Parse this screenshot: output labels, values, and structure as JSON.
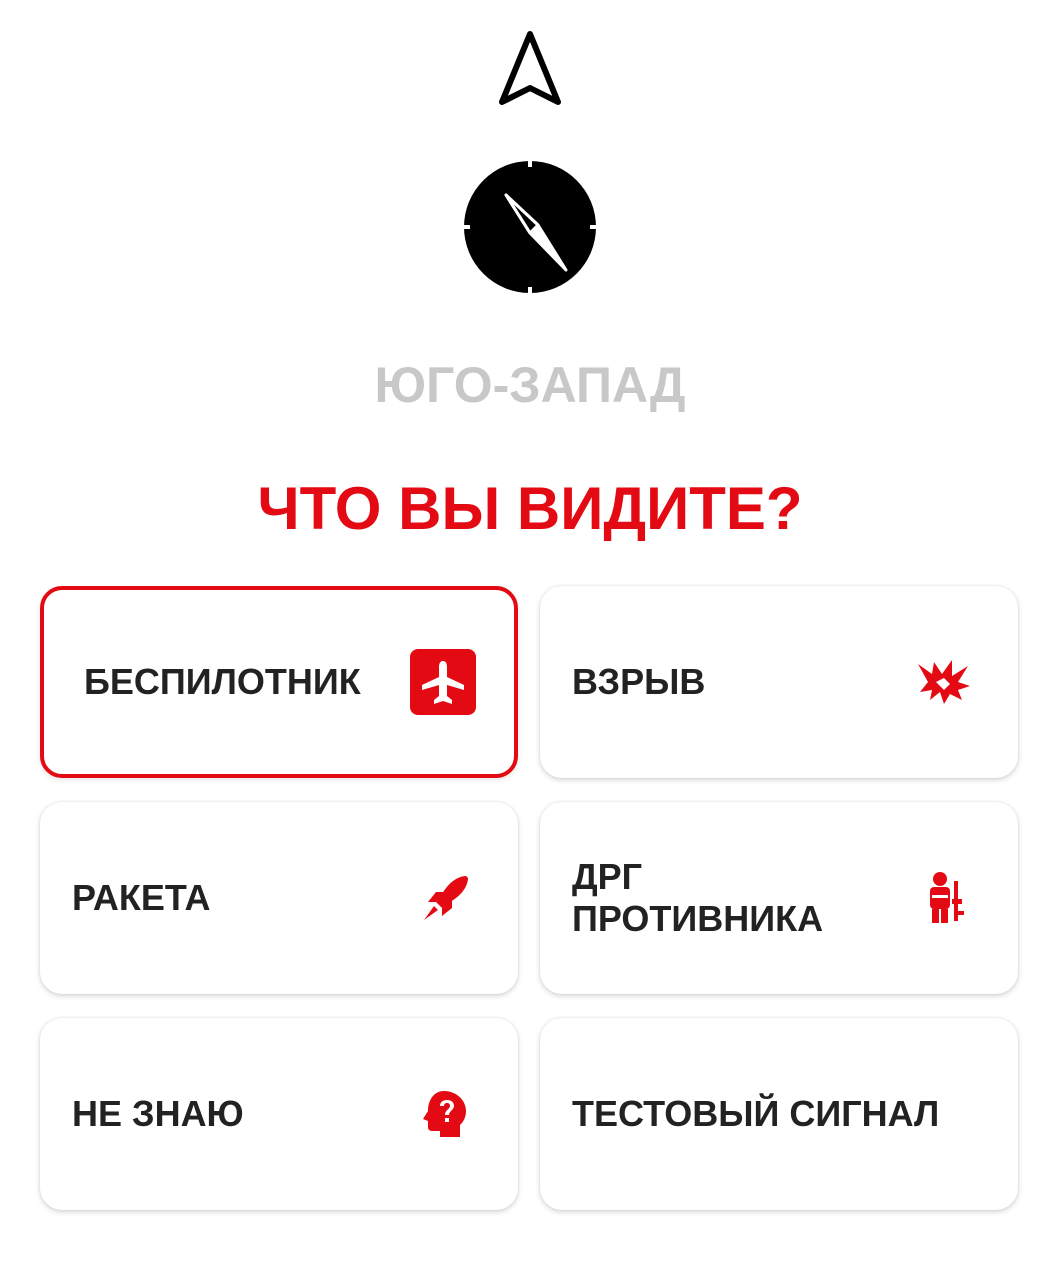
{
  "direction_label": "ЮГО-ЗАПАД",
  "question": "ЧТО ВЫ ВИДИТЕ?",
  "colors": {
    "accent": "#e30a13",
    "direction_text": "#c8c8c8",
    "card_text": "#222222"
  },
  "options": [
    {
      "label": "БЕСПИЛОТНИК",
      "icon": "airplane-icon",
      "selected": true
    },
    {
      "label": "ВЗРЫВ",
      "icon": "explosion-icon",
      "selected": false
    },
    {
      "label": "РАКЕТА",
      "icon": "rocket-icon",
      "selected": false
    },
    {
      "label": "ДРГ\nПРОТИВНИКА",
      "icon": "soldier-icon",
      "selected": false
    },
    {
      "label": "НЕ ЗНАЮ",
      "icon": "question-head-icon",
      "selected": false
    },
    {
      "label": "ТЕСТОВЫЙ СИГНАЛ",
      "icon": "",
      "selected": false
    }
  ]
}
